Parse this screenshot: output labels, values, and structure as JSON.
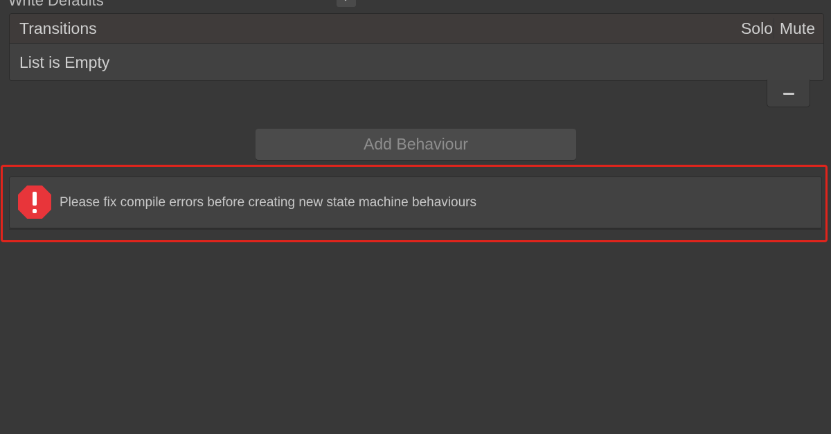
{
  "inspector": {
    "top_property_label": "Write Defaults",
    "transitions": {
      "title": "Transitions",
      "solo_label": "Solo",
      "mute_label": "Mute",
      "empty_text": "List is Empty"
    },
    "add_behaviour_label": "Add Behaviour",
    "help_box": {
      "message": "Please fix compile errors before creating new state machine behaviours",
      "icon": "error-icon"
    }
  },
  "colors": {
    "background": "#383838",
    "highlight": "#e0241c",
    "error_icon": "#e8353a"
  }
}
